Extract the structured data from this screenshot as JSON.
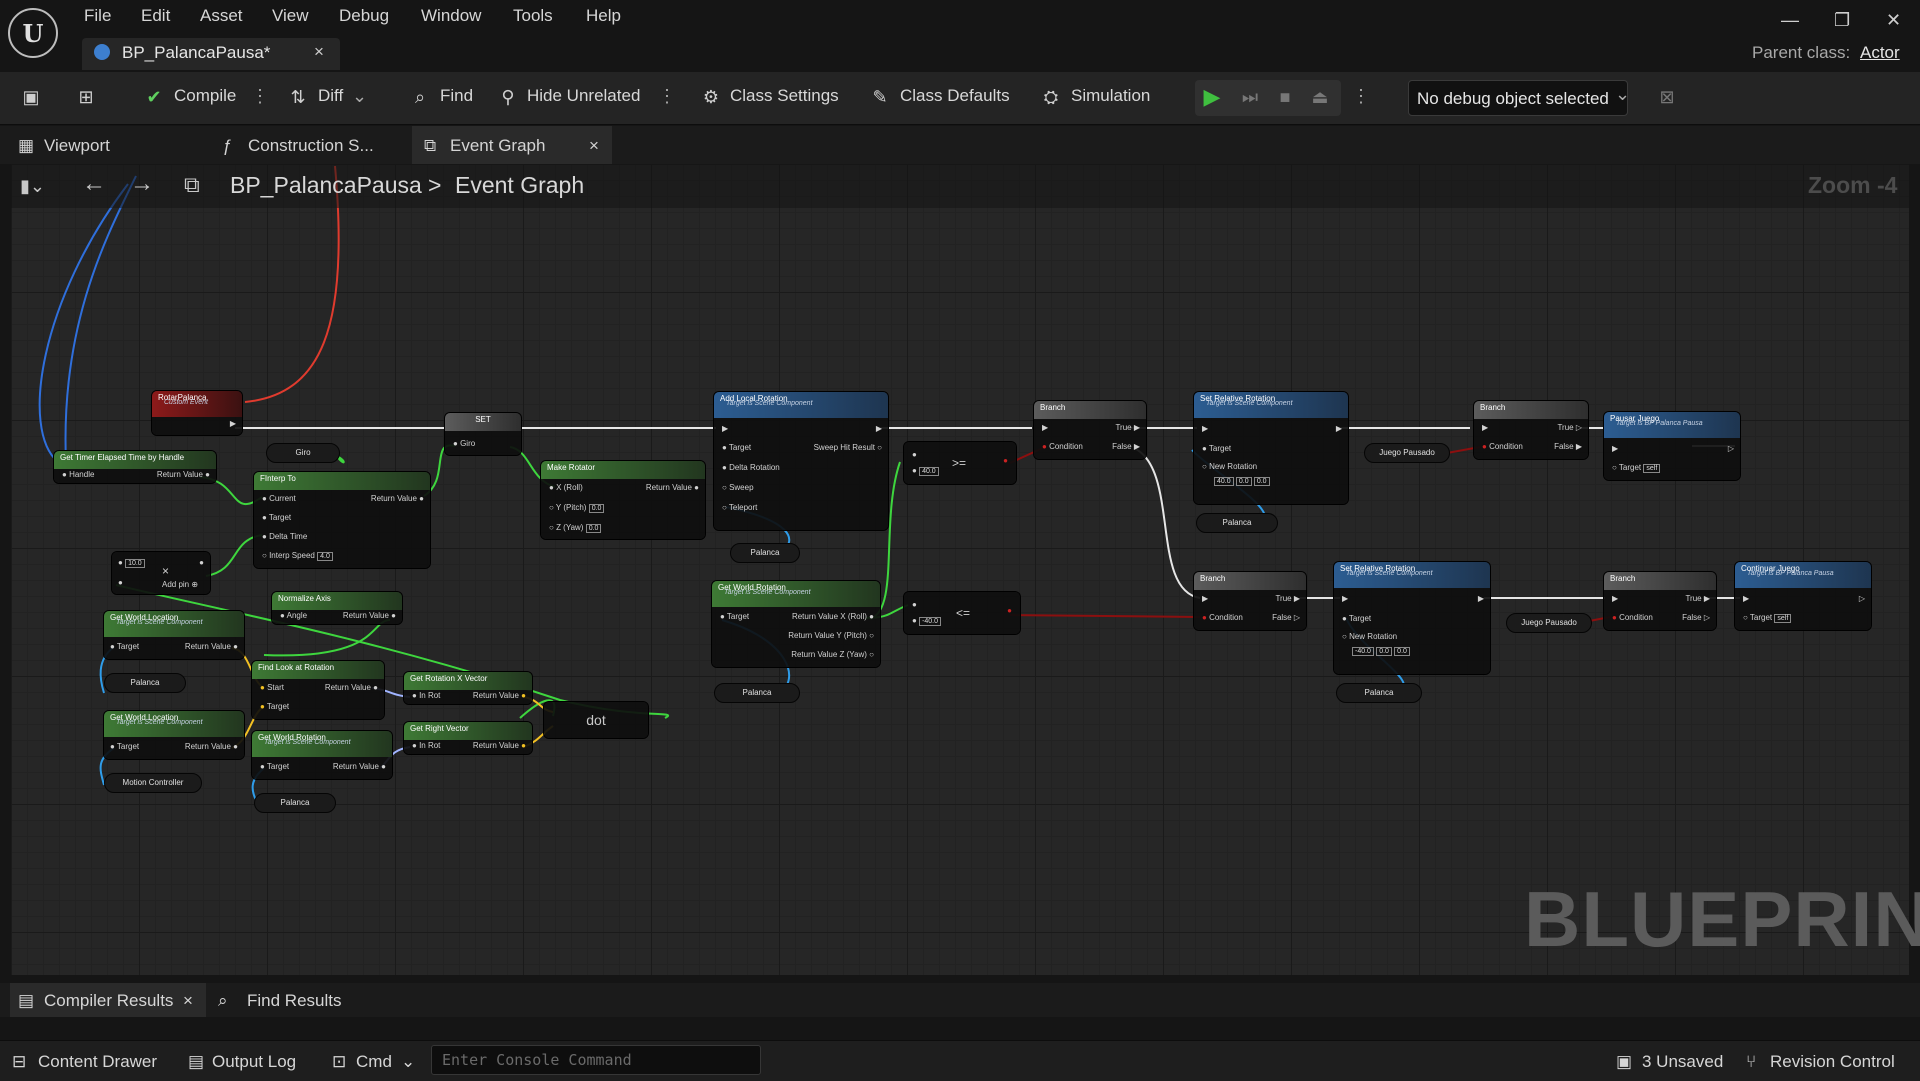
{
  "app": {
    "logo_text": "U"
  },
  "menu": [
    "File",
    "Edit",
    "Asset",
    "View",
    "Debug",
    "Window",
    "Tools",
    "Help"
  ],
  "asset_tab": {
    "label": "BP_PalancaPausa*",
    "close": "×"
  },
  "window_controls": {
    "minimize": "—",
    "restore": "❐",
    "close": "✕"
  },
  "parent_class": {
    "label": "Parent class:",
    "value": "Actor"
  },
  "toolbar": {
    "compile": "Compile",
    "diff": "Diff",
    "find": "Find",
    "hide_unrelated": "Hide Unrelated",
    "class_settings": "Class Settings",
    "class_defaults": "Class Defaults",
    "simulation": "Simulation",
    "debug_object": "No debug object selected"
  },
  "doc_tabs": {
    "viewport": "Viewport",
    "construction": "Construction S...",
    "event_graph": "Event Graph",
    "close": "×"
  },
  "breadcrumb": {
    "asset": "BP_PalancaPausa",
    "separator": ">",
    "graph": "Event Graph"
  },
  "zoom": "Zoom -4",
  "watermark": "BLUEPRINT",
  "nodes": {
    "rotar_palanca": {
      "title": "RotarPalanca",
      "subtitle": "Custom Event"
    },
    "get_timer": {
      "title": "Get Timer Elapsed Time by Handle",
      "pin_handle": "Handle",
      "pin_return": "Return Value"
    },
    "giro_var": {
      "label": "Giro"
    },
    "set": {
      "title": "SET",
      "pin_giro": "Giro"
    },
    "finterp": {
      "title": "FInterp To",
      "current": "Current",
      "target": "Target",
      "delta": "Delta Time",
      "speed": "Interp Speed",
      "speed_val": "4.0",
      "ret": "Return Value"
    },
    "make_rotator": {
      "title": "Make Rotator",
      "x": "X (Roll)",
      "y": "Y (Pitch)",
      "z": "Z (Yaw)",
      "y_val": "0.0",
      "z_val": "0.0",
      "ret": "Return Value"
    },
    "add_local_rotation": {
      "title": "Add Local Rotation",
      "subtitle": "Target is Scene Component",
      "target": "Target",
      "delta": "Delta Rotation",
      "sweep": "Sweep",
      "teleport": "Teleport",
      "sweep_hit": "Sweep Hit Result"
    },
    "palanca_1": {
      "label": "Palanca"
    },
    "ge_node": {
      "val": "40.0",
      "op": ">="
    },
    "le_node": {
      "val": "-40.0",
      "op": "<="
    },
    "get_world_rotation": {
      "title": "Get World Rotation",
      "subtitle": "Target is Scene Component",
      "target": "Target",
      "rx": "Return Value X (Roll)",
      "ry": "Return Value Y (Pitch)",
      "rz": "Return Value Z (Yaw)"
    },
    "palanca_2": {
      "label": "Palanca"
    },
    "branch_1": {
      "title": "Branch",
      "cond": "Condition",
      "t": "True",
      "f": "False"
    },
    "set_rel_rot_1": {
      "title": "Set Relative Rotation",
      "subtitle": "Target is Scene Component",
      "target": "Target",
      "newrot": "New Rotation",
      "x": "40.0",
      "y": "0.0",
      "z": "0.0"
    },
    "palanca_3": {
      "label": "Palanca"
    },
    "juego_pausado_1": {
      "label": "Juego Pausado"
    },
    "branch_2": {
      "title": "Branch",
      "cond": "Condition",
      "t": "True",
      "f": "False"
    },
    "pausar_juego": {
      "title": "Pausar Juego",
      "subtitle": "Target is BP Palanca Pausa",
      "target": "Target",
      "self": "self"
    },
    "branch_3": {
      "title": "Branch",
      "cond": "Condition",
      "t": "True",
      "f": "False"
    },
    "set_rel_rot_2": {
      "title": "Set Relative Rotation",
      "subtitle": "Target is Scene Component",
      "target": "Target",
      "newrot": "New Rotation",
      "x": "-40.0",
      "y": "0.0",
      "z": "0.0"
    },
    "palanca_4": {
      "label": "Palanca"
    },
    "juego_pausado_2": {
      "label": "Juego Pausado"
    },
    "branch_4": {
      "title": "Branch",
      "cond": "Condition",
      "t": "True",
      "f": "False"
    },
    "continuar_juego": {
      "title": "Continuar Juego",
      "subtitle": "Target is BP Palanca Pausa",
      "target": "Target",
      "self": "self"
    },
    "multiply": {
      "val": "10.0",
      "op": "×",
      "add_pin": "Add pin"
    },
    "normalize_axis": {
      "title": "Normalize Axis",
      "angle": "Angle",
      "ret": "Return Value"
    },
    "get_world_location_1": {
      "title": "Get World Location",
      "subtitle": "Target is Scene Component",
      "target": "Target",
      "ret": "Return Value"
    },
    "palanca_5": {
      "label": "Palanca"
    },
    "find_look_at": {
      "title": "Find Look at Rotation",
      "start": "Start",
      "target": "Target",
      "ret": "Return Value"
    },
    "get_rot_x": {
      "title": "Get Rotation X Vector",
      "in": "In Rot",
      "ret": "Return Value"
    },
    "dot": {
      "label": "dot"
    },
    "get_world_location_2": {
      "title": "Get World Location",
      "subtitle": "Target is Scene Component",
      "target": "Target",
      "ret": "Return Value"
    },
    "motion_controller": {
      "label": "Motion Controller"
    },
    "get_world_rotation_2": {
      "title": "Get World Rotation",
      "subtitle": "Target is Scene Component",
      "target": "Target",
      "ret": "Return Value"
    },
    "get_right_vector": {
      "title": "Get Right Vector",
      "in": "In Rot",
      "ret": "Return Value"
    },
    "palanca_6": {
      "label": "Palanca"
    }
  },
  "bottom_tabs": {
    "compiler": "Compiler Results",
    "compiler_close": "×",
    "find": "Find Results"
  },
  "status": {
    "content_drawer": "Content Drawer",
    "output_log": "Output Log",
    "cmd": "Cmd",
    "console_placeholder": "Enter Console Command",
    "unsaved": "3 Unsaved",
    "revision": "Revision Control"
  },
  "colors": {
    "exec": "#ffffff",
    "float_pin": "#3ed63e",
    "object_pin": "#2f9dea",
    "bool_pin": "#8c0f0f",
    "vector_pin": "#f2c023",
    "rotator_pin": "#a0b4ff",
    "event_wire": "#e03b2e",
    "play_green": "#3fbf3f"
  }
}
